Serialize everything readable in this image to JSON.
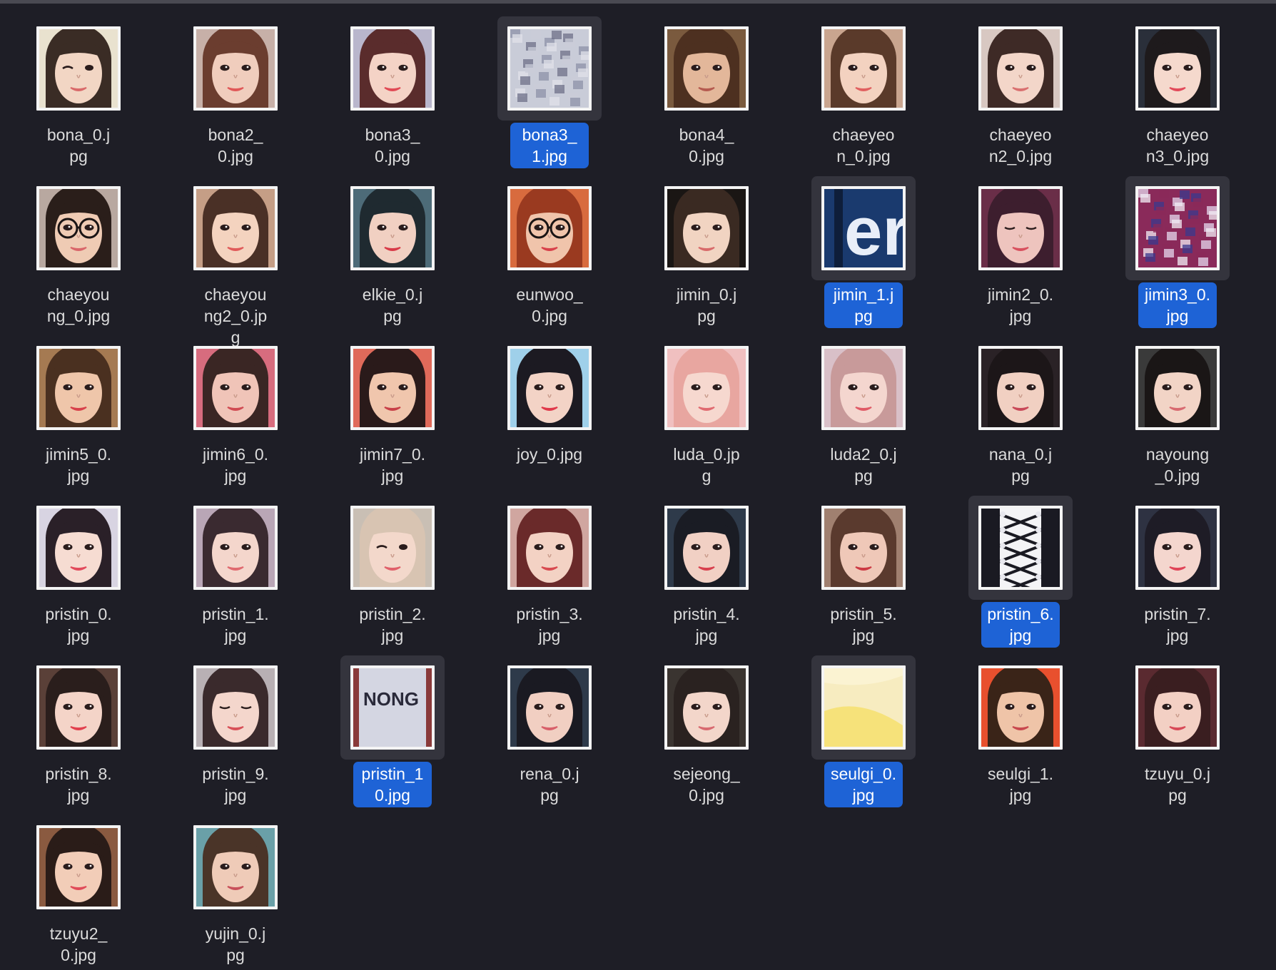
{
  "window": {
    "view": "icon-grid"
  },
  "colors": {
    "background": "#1e1e26",
    "selection": "#1e63d6",
    "label_text": "#dcdcdc"
  },
  "files": [
    {
      "name": "bona_0.jpg",
      "selected": false,
      "thumb": {
        "type": "face",
        "bg": "#e9e2cf",
        "skin": "#f2d6c4",
        "hair": "#3a2c25",
        "eyes": "wink",
        "lips": "#d96a6a"
      }
    },
    {
      "name": "bona2_0.jpg",
      "selected": false,
      "thumb": {
        "type": "face",
        "bg": "#c7b0a8",
        "skin": "#f0cdbd",
        "hair": "#6b3d2f",
        "eyes": "open",
        "lips": "#e05858"
      }
    },
    {
      "name": "bona3_0.jpg",
      "selected": false,
      "thumb": {
        "type": "face",
        "bg": "#b9b6cc",
        "skin": "#f4d3c6",
        "hair": "#5a2c2c",
        "eyes": "open",
        "lips": "#e04a55"
      }
    },
    {
      "name": "bona3_1.jpg",
      "selected": true,
      "thumb": {
        "type": "blur",
        "colors": [
          "#8c92a8",
          "#c9ccd8",
          "#6d7088",
          "#e0e2ea"
        ]
      }
    },
    {
      "name": "bona4_0.jpg",
      "selected": false,
      "thumb": {
        "type": "face",
        "bg": "#7a5a3e",
        "skin": "#e3b79a",
        "hair": "#4d3020",
        "eyes": "open",
        "lips": "#b55a4f"
      }
    },
    {
      "name": "chaeyeon_0.jpg",
      "selected": false,
      "thumb": {
        "type": "face",
        "bg": "#c9a58f",
        "skin": "#f3d2c0",
        "hair": "#5a3a2a",
        "eyes": "open",
        "lips": "#e06060"
      }
    },
    {
      "name": "chaeyeon2_0.jpg",
      "selected": false,
      "thumb": {
        "type": "face",
        "bg": "#d8c8c2",
        "skin": "#f3d6c9",
        "hair": "#3e2a26",
        "eyes": "open",
        "lips": "#d97070"
      }
    },
    {
      "name": "chaeyeon3_0.jpg",
      "selected": false,
      "thumb": {
        "type": "face",
        "bg": "#2a2f3a",
        "skin": "#f5d9cd",
        "hair": "#1e1a1c",
        "eyes": "open",
        "lips": "#e24a5a"
      }
    },
    {
      "name": "chaeyoung_0.jpg",
      "selected": false,
      "thumb": {
        "type": "face",
        "bg": "#b8a8a0",
        "skin": "#efcbb4",
        "hair": "#2a1e1a",
        "eyes": "glasses",
        "lips": "#d9666a"
      }
    },
    {
      "name": "chaeyoung2_0.jpg",
      "selected": false,
      "thumb": {
        "type": "face",
        "bg": "#c59e86",
        "skin": "#f4d3bf",
        "hair": "#4a3026",
        "eyes": "open",
        "lips": "#e05a5a"
      }
    },
    {
      "name": "elkie_0.jpg",
      "selected": false,
      "thumb": {
        "type": "face",
        "bg": "#4d6b78",
        "skin": "#f1d0c2",
        "hair": "#1f2a30",
        "eyes": "open",
        "lips": "#d83a48"
      }
    },
    {
      "name": "eunwoo_0.jpg",
      "selected": false,
      "thumb": {
        "type": "face",
        "bg": "#d86b3e",
        "skin": "#f0c4ab",
        "hair": "#9a3a20",
        "eyes": "glasses",
        "lips": "#d8404a"
      }
    },
    {
      "name": "jimin_0.jpg",
      "selected": false,
      "thumb": {
        "type": "face",
        "bg": "#1a1614",
        "skin": "#f1d4c2",
        "hair": "#3a2a22",
        "eyes": "open",
        "lips": "#d86a6a"
      }
    },
    {
      "name": "jimin_1.jpg",
      "selected": true,
      "thumb": {
        "type": "letters",
        "bg": "#1a3a6e",
        "fg": "#e8eef8",
        "text": "er"
      }
    },
    {
      "name": "jimin2_0.jpg",
      "selected": false,
      "thumb": {
        "type": "face",
        "bg": "#6a2e48",
        "skin": "#eec4be",
        "hair": "#3d1e2e",
        "eyes": "closed",
        "lips": "#d8505e"
      }
    },
    {
      "name": "jimin3_0.jpg",
      "selected": true,
      "thumb": {
        "type": "blur",
        "colors": [
          "#e4d8ee",
          "#8a2a5a",
          "#3a3a8e",
          "#f2eef6"
        ]
      }
    },
    {
      "name": "jimin5_0.jpg",
      "selected": false,
      "thumb": {
        "type": "face",
        "bg": "#a57a52",
        "skin": "#efc6aa",
        "hair": "#4a3020",
        "eyes": "open",
        "lips": "#d8404a"
      }
    },
    {
      "name": "jimin6_0.jpg",
      "selected": false,
      "thumb": {
        "type": "face",
        "bg": "#d76c7e",
        "skin": "#f0c4b8",
        "hair": "#3a2624",
        "eyes": "open",
        "lips": "#d04a52"
      }
    },
    {
      "name": "jimin7_0.jpg",
      "selected": false,
      "thumb": {
        "type": "face",
        "bg": "#e06a5a",
        "skin": "#f0c6ad",
        "hair": "#2a1a1a",
        "eyes": "open",
        "lips": "#c84048"
      }
    },
    {
      "name": "joy_0.jpg",
      "selected": false,
      "thumb": {
        "type": "face",
        "bg": "#9fd0ea",
        "skin": "#f3d3c6",
        "hair": "#1c1a22",
        "eyes": "open",
        "lips": "#e0384a"
      }
    },
    {
      "name": "luda_0.jpg",
      "selected": false,
      "thumb": {
        "type": "face",
        "bg": "#f0c0c0",
        "skin": "#f6d8cf",
        "hair": "#e8a6a0",
        "eyes": "open",
        "lips": "#e06a70"
      }
    },
    {
      "name": "luda2_0.jpg",
      "selected": false,
      "thumb": {
        "type": "face",
        "bg": "#d9c0c8",
        "skin": "#f4d6cf",
        "hair": "#c89a9a",
        "eyes": "open",
        "lips": "#e05a66"
      }
    },
    {
      "name": "nana_0.jpg",
      "selected": false,
      "thumb": {
        "type": "face",
        "bg": "#2a2226",
        "skin": "#f1d0c2",
        "hair": "#1c1618",
        "eyes": "open",
        "lips": "#c84858"
      }
    },
    {
      "name": "nayoung_0.jpg",
      "selected": false,
      "thumb": {
        "type": "face",
        "bg": "#3a3a3a",
        "skin": "#f2d4c6",
        "hair": "#1a1616",
        "eyes": "open",
        "lips": "#d86a70"
      }
    },
    {
      "name": "pristin_0.jpg",
      "selected": false,
      "thumb": {
        "type": "face",
        "bg": "#d8d4e2",
        "skin": "#f6dcd2",
        "hair": "#2a2028",
        "eyes": "open",
        "lips": "#e24a5c"
      }
    },
    {
      "name": "pristin_1.jpg",
      "selected": false,
      "thumb": {
        "type": "face",
        "bg": "#b9a6b6",
        "skin": "#f4d6cc",
        "hair": "#3a2a30",
        "eyes": "open",
        "lips": "#e06a70"
      }
    },
    {
      "name": "pristin_2.jpg",
      "selected": false,
      "thumb": {
        "type": "face",
        "bg": "#c9bfb4",
        "skin": "#f3d8cb",
        "hair": "#d8c4b2",
        "eyes": "wink",
        "lips": "#e0606a"
      }
    },
    {
      "name": "pristin_3.jpg",
      "selected": false,
      "thumb": {
        "type": "face",
        "bg": "#d0a6a0",
        "skin": "#f3d2c4",
        "hair": "#6a2a2a",
        "eyes": "open",
        "lips": "#d84a50"
      }
    },
    {
      "name": "pristin_4.jpg",
      "selected": false,
      "thumb": {
        "type": "face",
        "bg": "#2e3a4a",
        "skin": "#f1d0c4",
        "hair": "#1a1c24",
        "eyes": "open",
        "lips": "#d8404e"
      }
    },
    {
      "name": "pristin_5.jpg",
      "selected": false,
      "thumb": {
        "type": "face",
        "bg": "#a08070",
        "skin": "#efc8b8",
        "hair": "#5a3a2e",
        "eyes": "open",
        "lips": "#cc3a44"
      }
    },
    {
      "name": "pristin_6.jpg",
      "selected": true,
      "thumb": {
        "type": "lace",
        "bg": "#f4f4f6",
        "fg": "#1a1a22"
      }
    },
    {
      "name": "pristin_7.jpg",
      "selected": false,
      "thumb": {
        "type": "face",
        "bg": "#2e3242",
        "skin": "#f4d6ce",
        "hair": "#1e1c26",
        "eyes": "open",
        "lips": "#e04458"
      }
    },
    {
      "name": "pristin_8.jpg",
      "selected": false,
      "thumb": {
        "type": "face",
        "bg": "#5a4038",
        "skin": "#f4d4c8",
        "hair": "#2a1e1c",
        "eyes": "open",
        "lips": "#e2404e"
      }
    },
    {
      "name": "pristin_9.jpg",
      "selected": false,
      "thumb": {
        "type": "face",
        "bg": "#b8b0b4",
        "skin": "#f4d6cc",
        "hair": "#3a2a2c",
        "eyes": "closed",
        "lips": "#d85058"
      }
    },
    {
      "name": "pristin_10.jpg",
      "selected": true,
      "thumb": {
        "type": "text",
        "bg": "#d4d6e2",
        "side": "#8a3a3a",
        "fg": "#2a2a3a",
        "text": "NONG"
      }
    },
    {
      "name": "rena_0.jpg",
      "selected": false,
      "thumb": {
        "type": "face",
        "bg": "#2e3a4a",
        "skin": "#f1cfc2",
        "hair": "#1a1a22",
        "eyes": "open",
        "lips": "#d8606a"
      }
    },
    {
      "name": "sejeong_0.jpg",
      "selected": false,
      "thumb": {
        "type": "face",
        "bg": "#3a3430",
        "skin": "#f3d6ca",
        "hair": "#2a2220",
        "eyes": "open",
        "lips": "#d86a70"
      }
    },
    {
      "name": "seulgi_0.jpg",
      "selected": true,
      "thumb": {
        "type": "yellow",
        "bg": "#f7ecc0",
        "fg": "#f6e27a"
      }
    },
    {
      "name": "seulgi_1.jpg",
      "selected": false,
      "thumb": {
        "type": "face",
        "bg": "#e8502e",
        "skin": "#efc4a8",
        "hair": "#3a2418",
        "eyes": "open",
        "lips": "#c8484e"
      }
    },
    {
      "name": "tzuyu_0.jpg",
      "selected": false,
      "thumb": {
        "type": "face",
        "bg": "#5a2a30",
        "skin": "#f3d0c4",
        "hair": "#3a1e20",
        "eyes": "open",
        "lips": "#d84a58"
      }
    },
    {
      "name": "tzuyu2_0.jpg",
      "selected": false,
      "thumb": {
        "type": "face",
        "bg": "#8a5a40",
        "skin": "#f2cdb8",
        "hair": "#2a1c18",
        "eyes": "open",
        "lips": "#e04a58"
      }
    },
    {
      "name": "yujin_0.jpg",
      "selected": false,
      "thumb": {
        "type": "face",
        "bg": "#6aa0a8",
        "skin": "#efcbb8",
        "hair": "#4a3428",
        "eyes": "open",
        "lips": "#c8505a"
      }
    }
  ]
}
